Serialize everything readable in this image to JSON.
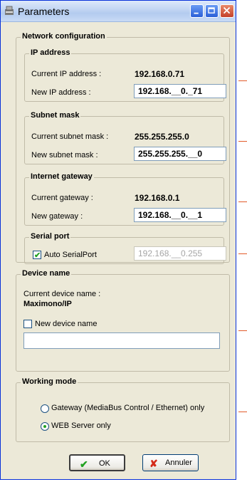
{
  "window": {
    "title": "Parameters"
  },
  "network": {
    "legend": "Network configuration",
    "ip": {
      "legend": "IP address",
      "current_label": "Current IP address :",
      "current_value": "192.168.0.71",
      "new_label": "New IP address :",
      "new_value": "192.168.__0._71"
    },
    "subnet": {
      "legend": "Subnet mask",
      "current_label": "Current subnet mask :",
      "current_value": "255.255.255.0",
      "new_label": "New subnet mask :",
      "new_value": "255.255.255.__0"
    },
    "gateway": {
      "legend": "Internet gateway",
      "current_label": "Current gateway :",
      "current_value": "192.168.0.1",
      "new_label": "New gateway :",
      "new_value": "192.168.__0.__1"
    },
    "serial": {
      "legend": "Serial port",
      "auto_label": "Auto SerialPort",
      "auto_checked": true,
      "value": "192.168.__0.255"
    }
  },
  "device": {
    "legend": "Device name",
    "current_label": "Current device name :",
    "current_value": "Maximono/IP",
    "new_label": "New device name",
    "new_checked": false,
    "new_value": ""
  },
  "working_mode": {
    "legend": "Working mode",
    "options": [
      {
        "label": "Gateway (MediaBus Control / Ethernet) only",
        "selected": false
      },
      {
        "label": "WEB Server only",
        "selected": true
      }
    ]
  },
  "buttons": {
    "ok_label": "OK",
    "cancel_label": "Annuler"
  },
  "colors": {
    "accent": "#e25b2b",
    "check": "#21a121",
    "cancel_icon": "#d42a1a"
  }
}
